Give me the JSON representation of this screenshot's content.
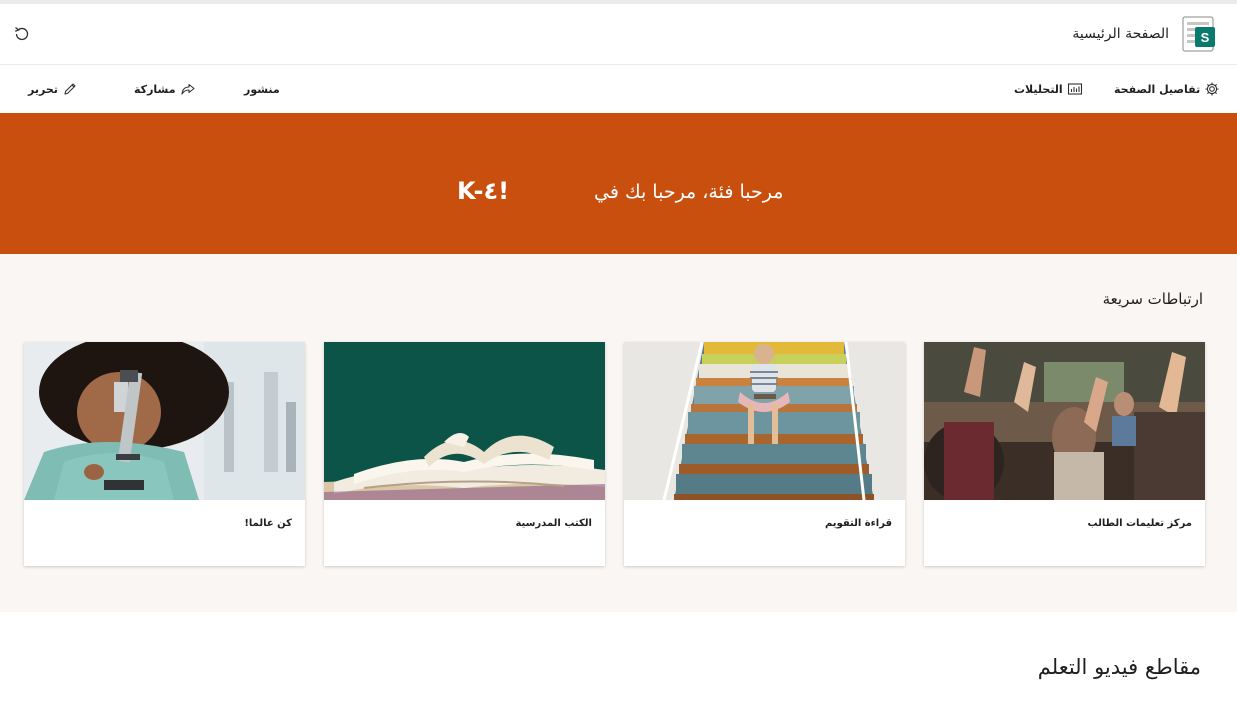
{
  "header": {
    "site_title": "الصفحة الرئيسية",
    "logo_letter": "S"
  },
  "commandbar": {
    "page_details": "تفاصيل الصفحة",
    "analytics": "التحليلات",
    "published": "منشور",
    "share": "مشاركة",
    "edit": "تحرير"
  },
  "banner": {
    "welcome": "مرحبا فئة، مرحبا بك في",
    "grade": "K-٤!"
  },
  "quick_links": {
    "title": "ارتباطات سريعة",
    "cards": [
      {
        "caption": "مركز تعليمات الطالب",
        "image": "raised-hands-classroom"
      },
      {
        "caption": "قراءة التقويم",
        "image": "girl-reading-on-stairs"
      },
      {
        "caption": "الكتب المدرسية",
        "image": "open-books-chalkboard"
      },
      {
        "caption": "كن عالما!",
        "image": "child-microscope"
      }
    ]
  },
  "videos": {
    "title": "مقاطع فيديو التعلم"
  },
  "colors": {
    "banner": "#c94f0f",
    "section_bg": "#faf6f3",
    "logo_teal": "#0b7a6e"
  }
}
